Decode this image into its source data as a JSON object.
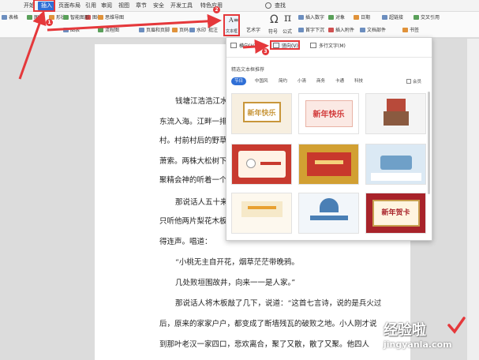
{
  "menu": {
    "items": [
      "开始",
      "插入",
      "页面布局",
      "引用",
      "审阅",
      "视图",
      "章节",
      "安全",
      "开发工具",
      "特色应用",
      "查找"
    ],
    "active": "插入"
  },
  "ribbon": {
    "row1": [
      "表格",
      "图片",
      "形状",
      "图标",
      "智能图形",
      "图表",
      "思维导图",
      "流程图",
      "页眉和页脚",
      "页码",
      "水印",
      "批注",
      "文本框",
      "艺术字",
      "符号",
      "公式",
      "插入数字",
      "对象",
      "日期",
      "首字下沉",
      "插入附件",
      "文档部件",
      "超链接",
      "交叉引用",
      "书签"
    ],
    "textbox_label": "文本框",
    "formula_glyph": "π"
  },
  "dropdown": {
    "options": [
      {
        "label": "横向(H)",
        "icon": "horizontal-textbox-icon"
      },
      {
        "label": "竖向(V)",
        "icon": "vertical-textbox-icon"
      },
      {
        "label": "多行文字(M)",
        "icon": "multiline-text-icon"
      }
    ],
    "section_title": "精选文本框推荐",
    "categories": [
      "节日",
      "中国风",
      "简约",
      "小清",
      "商务",
      "卡通",
      "科技"
    ],
    "active_category": "节日",
    "checkbox_label": "会员",
    "thumbnails": [
      {
        "title": "新年快乐",
        "color": "#c8963a"
      },
      {
        "title": "新年快乐",
        "color": "#d23a3a"
      },
      {
        "title": "",
        "color": "#b84a3a"
      },
      {
        "title": "",
        "color": "#c83a2f"
      },
      {
        "title": "",
        "color": "#d2a032"
      },
      {
        "title": "",
        "color": "#6fa0c8"
      },
      {
        "title": "",
        "color": "#e8a030"
      },
      {
        "title": "",
        "color": "#4a7fb5"
      },
      {
        "title": "新年贺卡",
        "color": "#c8a050"
      }
    ]
  },
  "document": {
    "lines": [
      "钱塘江浩浩江水",
      "东流入海。江畔一排",
      "村。村前村后的野草",
      "萧索。两株大松树下",
      "聚精会神的听着一个",
      "那说话人五十来",
      "只听他两片梨花木板",
      "得连声。唱道：",
      "“小桃无主自开花，烟草茫茫带晚鸦。",
      "几处败垣围故井，向来一一是人家。”",
      "那说话人将木板敲了几下，说道：“这首七言诗，说的是兵火过",
      "后，原来的家家户户，都变成了断墙残瓦的破败之地。小人刚才说",
      "到那叶老汉一家四口，悲欢离合，聚了又散，散了又聚。他四人"
    ]
  },
  "badges": [
    "1",
    "2",
    "3"
  ],
  "watermark": {
    "cn": "经验啦",
    "url": "jingyanla.com"
  }
}
